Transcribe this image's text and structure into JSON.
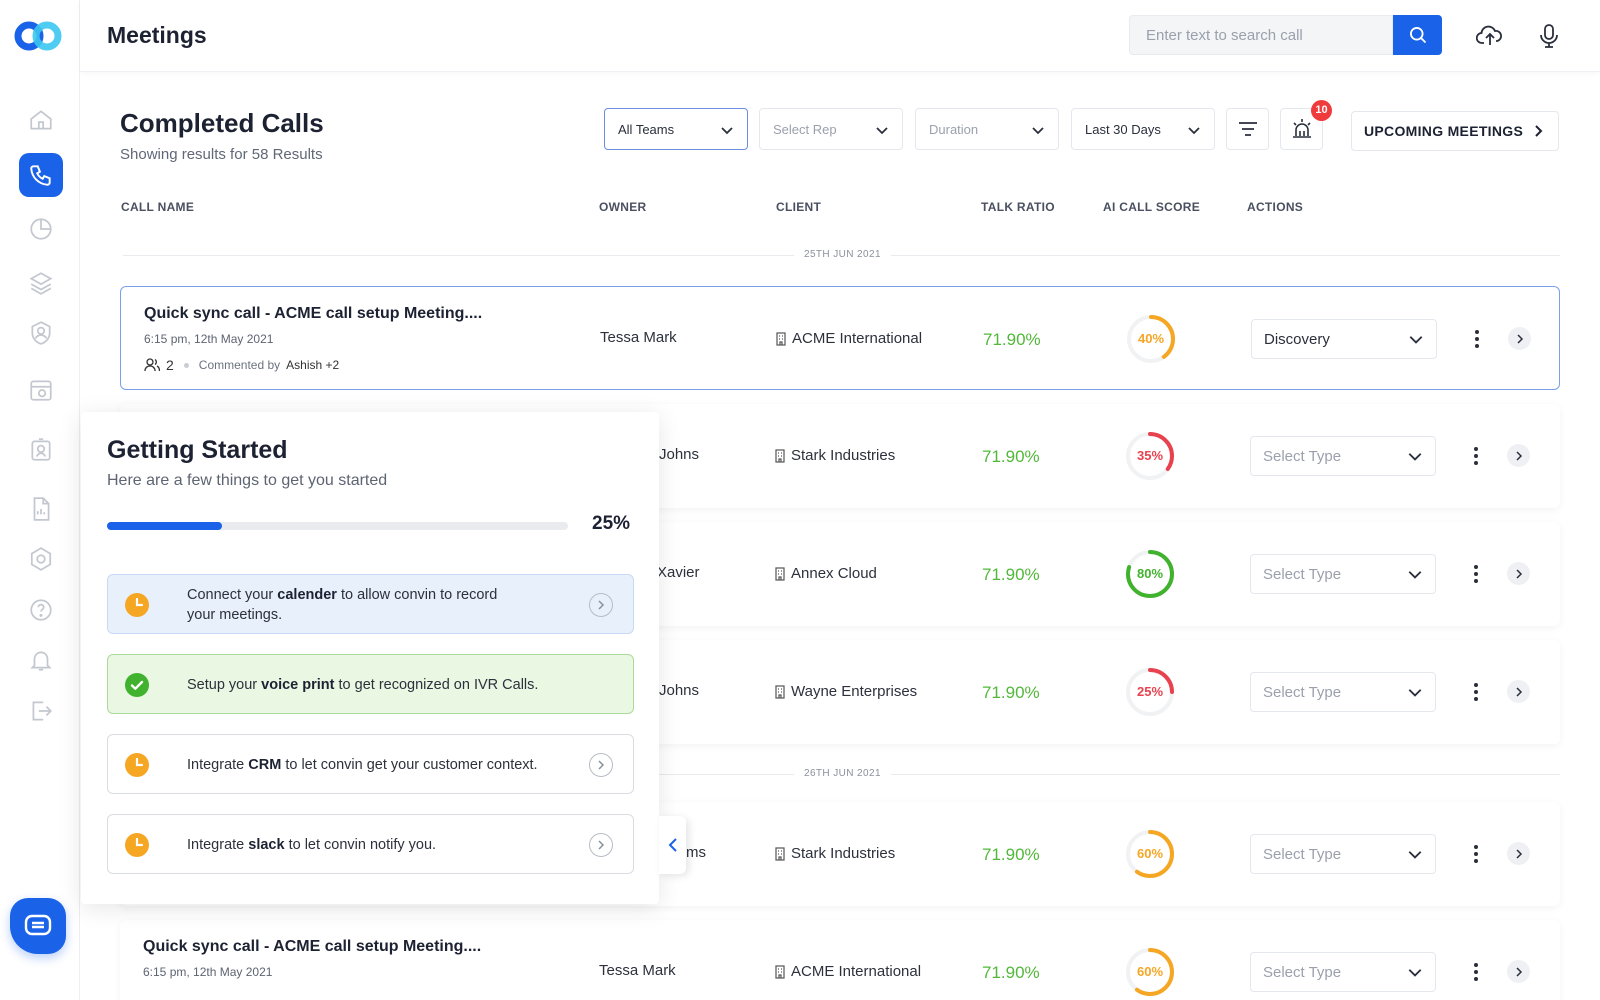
{
  "app": {
    "title": "Meetings"
  },
  "topbar": {
    "search_placeholder": "Enter text to search call"
  },
  "section": {
    "title": "Completed Calls",
    "subtitle": "Showing results for 58 Results"
  },
  "filters": {
    "teams": "All Teams",
    "rep": "Select Rep",
    "duration": "Duration",
    "period": "Last 30 Days",
    "alerts_count": "10",
    "upcoming": "UPCOMING MEETINGS"
  },
  "columns": [
    "CALL NAME",
    "OWNER",
    "CLIENT",
    "TALK RATIO",
    "AI CALL SCORE",
    "ACTIONS"
  ],
  "date_groups": [
    "25TH JUN 2021",
    "26TH JUN 2021"
  ],
  "rows": [
    {
      "name": "Quick sync call - ACME call setup Meeting....",
      "time": "6:15 pm, 12th May 2021",
      "participants": "2",
      "commented_by_label": "Commented by",
      "commented_by": "Ashish +2",
      "owner": "Tessa Mark",
      "client": "ACME International",
      "talk_ratio": "71.90%",
      "score": 40,
      "score_label": "40%",
      "score_color": "#f5a623",
      "type": "Discovery"
    },
    {
      "name": "",
      "time": "",
      "owner": "Johns",
      "client": "Stark Industries",
      "talk_ratio": "71.90%",
      "score": 35,
      "score_label": "35%",
      "score_color": "#e8424f",
      "type": "Select Type"
    },
    {
      "name": "",
      "time": "",
      "owner": "Xavier",
      "client": "Annex Cloud",
      "talk_ratio": "71.90%",
      "score": 80,
      "score_label": "80%",
      "score_color": "#41b22e",
      "type": "Select Type"
    },
    {
      "name": "",
      "time": "",
      "owner": "Johns",
      "client": "Wayne Enterprises",
      "talk_ratio": "71.90%",
      "score": 25,
      "score_label": "25%",
      "score_color": "#e8424f",
      "type": "Select Type"
    },
    {
      "name": "",
      "time": "",
      "owner": "ms",
      "client": "Stark Industries",
      "talk_ratio": "71.90%",
      "score": 60,
      "score_label": "60%",
      "score_color": "#f5a623",
      "type": "Select Type"
    },
    {
      "name": "Quick sync call - ACME call setup Meeting....",
      "time": "6:15 pm, 12th May 2021",
      "owner": "Tessa Mark",
      "client": "ACME International",
      "talk_ratio": "71.90%",
      "score": 60,
      "score_label": "60%",
      "score_color": "#f5a623",
      "type": "Select Type"
    }
  ],
  "getting_started": {
    "title": "Getting Started",
    "subtitle": "Here are a few things to get you started",
    "progress": 0.25,
    "progress_label": "25%",
    "tasks": [
      {
        "pre": "Connect your ",
        "bold": "calender",
        "post": " to allow convin to record",
        "line2": "your meetings.",
        "status": "pending"
      },
      {
        "pre": "Setup your ",
        "bold": "voice print",
        "post": " to get recognized on IVR Calls.",
        "status": "done"
      },
      {
        "pre": "Integrate ",
        "bold": "CRM",
        "post": " to let convin get your customer context.",
        "status": "pending"
      },
      {
        "pre": "Integrate ",
        "bold": "slack",
        "post": " to let convin notify you.",
        "status": "pending"
      }
    ]
  },
  "colors": {
    "primary": "#1a62e8",
    "talk_ratio": "#52b83a",
    "pending": "#f5a623",
    "done": "#41b22e",
    "badge": "#ef3b3b"
  },
  "icons": [
    "home-icon",
    "phone-icon",
    "clock-icon",
    "layers-icon",
    "user-settings-icon",
    "calendar-icon",
    "profile-icon",
    "document-icon",
    "settings-icon",
    "help-icon",
    "bell-icon",
    "logout-icon",
    "search-icon",
    "cloud-upload-icon",
    "microphone-icon",
    "filter-icon",
    "alarm-icon",
    "chat-icon"
  ]
}
